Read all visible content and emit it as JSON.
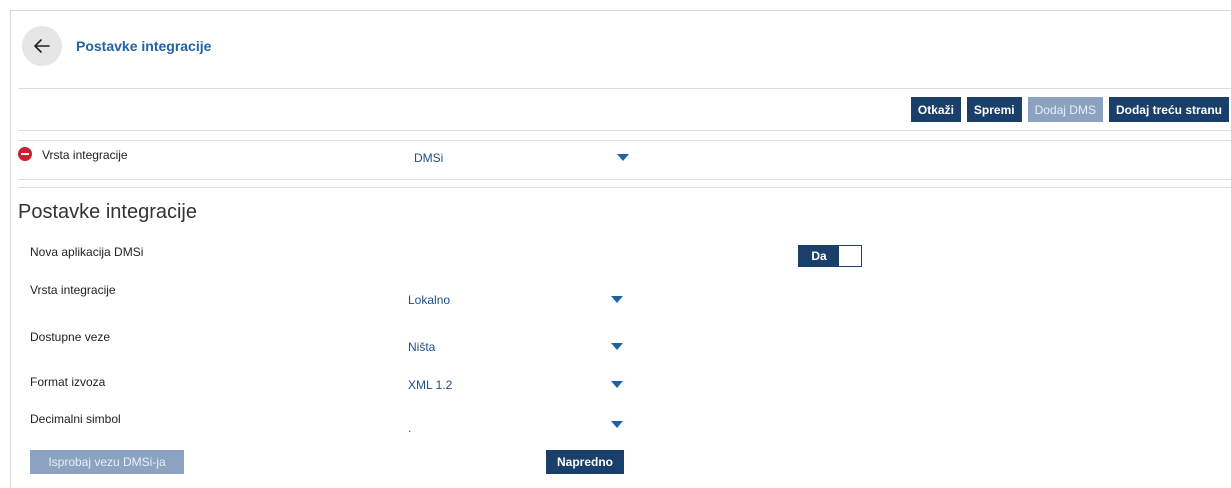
{
  "header": {
    "title": "Postavke integracije",
    "back_icon": "arrow-left-icon"
  },
  "toolbar": {
    "cancel_label": "Otkaži",
    "save_label": "Spremi",
    "add_dms_label": "Dodaj DMS",
    "add_third_party_label": "Dodaj treću stranu"
  },
  "integration_type_row": {
    "icon": "remove-circle-icon",
    "label": "Vrsta integracije",
    "value": "DMSi"
  },
  "settings": {
    "section_title": "Postavke integracije",
    "new_app": {
      "label": "Nova aplikacija DMSi",
      "toggle_value": "Da"
    },
    "integration_type": {
      "label": "Vrsta integracije",
      "value": "Lokalno"
    },
    "available_connections": {
      "label": "Dostupne veze",
      "value": "Ništa"
    },
    "export_format": {
      "label": "Format izvoza",
      "value": "XML 1.2"
    },
    "decimal_symbol": {
      "label": "Decimalni simbol",
      "value": "."
    },
    "test_connection_label": "Isprobaj vezu DMSi-ja",
    "advanced_label": "Napredno"
  },
  "colors": {
    "accent": "#1f63a6",
    "button": "#1b3f6b",
    "button_disabled": "#8ba3c1",
    "danger": "#c8212f"
  }
}
